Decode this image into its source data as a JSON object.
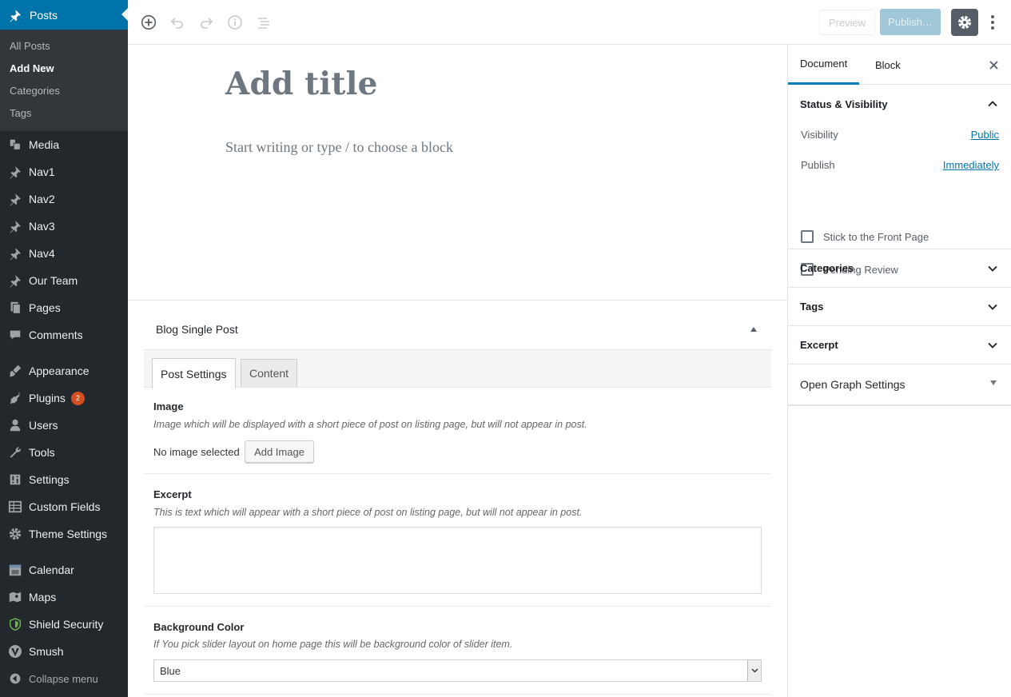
{
  "admin_menu": {
    "current": {
      "label": "Posts",
      "icon": "pushpin-icon"
    },
    "submenu": [
      {
        "label": "All Posts",
        "current": false
      },
      {
        "label": "Add New",
        "current": true
      },
      {
        "label": "Categories",
        "current": false
      },
      {
        "label": "Tags",
        "current": false
      }
    ],
    "items": [
      {
        "label": "Media",
        "icon": "media-icon"
      },
      {
        "label": "Nav1",
        "icon": "pushpin-icon"
      },
      {
        "label": "Nav2",
        "icon": "pushpin-icon"
      },
      {
        "label": "Nav3",
        "icon": "pushpin-icon"
      },
      {
        "label": "Nav4",
        "icon": "pushpin-icon"
      },
      {
        "label": "Our Team",
        "icon": "pushpin-icon"
      },
      {
        "label": "Pages",
        "icon": "pages-icon"
      },
      {
        "label": "Comments",
        "icon": "comments-icon"
      }
    ],
    "items2": [
      {
        "label": "Appearance",
        "icon": "paintbrush-icon"
      },
      {
        "label": "Plugins",
        "icon": "plugin-icon",
        "badge": "2"
      },
      {
        "label": "Users",
        "icon": "user-icon"
      },
      {
        "label": "Tools",
        "icon": "wrench-icon"
      },
      {
        "label": "Settings",
        "icon": "sliders-icon"
      },
      {
        "label": "Custom Fields",
        "icon": "table-icon"
      },
      {
        "label": "Theme Settings",
        "icon": "gear-icon"
      }
    ],
    "items3": [
      {
        "label": "Calendar",
        "icon": "calendar-icon"
      },
      {
        "label": "Maps",
        "icon": "map-icon"
      },
      {
        "label": "Shield Security",
        "icon": "shield-icon"
      },
      {
        "label": "Smush",
        "icon": "smush-icon"
      }
    ],
    "collapse_label": "Collapse menu"
  },
  "toolbar": {
    "preview_label": "Preview",
    "publish_label": "Publish…",
    "accent": "#0073aa"
  },
  "editor": {
    "title_placeholder": "Add title",
    "block_placeholder": "Start writing or type / to choose a block"
  },
  "metabox": {
    "title": "Blog Single Post",
    "tabs": [
      "Post Settings",
      "Content"
    ],
    "image": {
      "label": "Image",
      "description": "Image which will be displayed with a short piece of post on listing page, but will not appear in post.",
      "status": "No image selected",
      "button": "Add Image"
    },
    "excerpt": {
      "label": "Excerpt",
      "description": "This is text which will appear with a short piece of post on listing page, but will not appear in post.",
      "value": ""
    },
    "background": {
      "label": "Background Color",
      "description": "If You pick slider layout on home page this will be background color of slider item.",
      "selected": "Blue"
    }
  },
  "sidebar": {
    "tabs": [
      "Document",
      "Block"
    ],
    "status": {
      "title": "Status & Visibility",
      "visibility_label": "Visibility",
      "visibility_value": "Public",
      "publish_label": "Publish",
      "publish_value": "Immediately",
      "sticky_label": "Stick to the Front Page",
      "pending_label": "Pending Review"
    },
    "panels": [
      "Categories",
      "Tags",
      "Excerpt"
    ],
    "og_title": "Open Graph Settings"
  }
}
